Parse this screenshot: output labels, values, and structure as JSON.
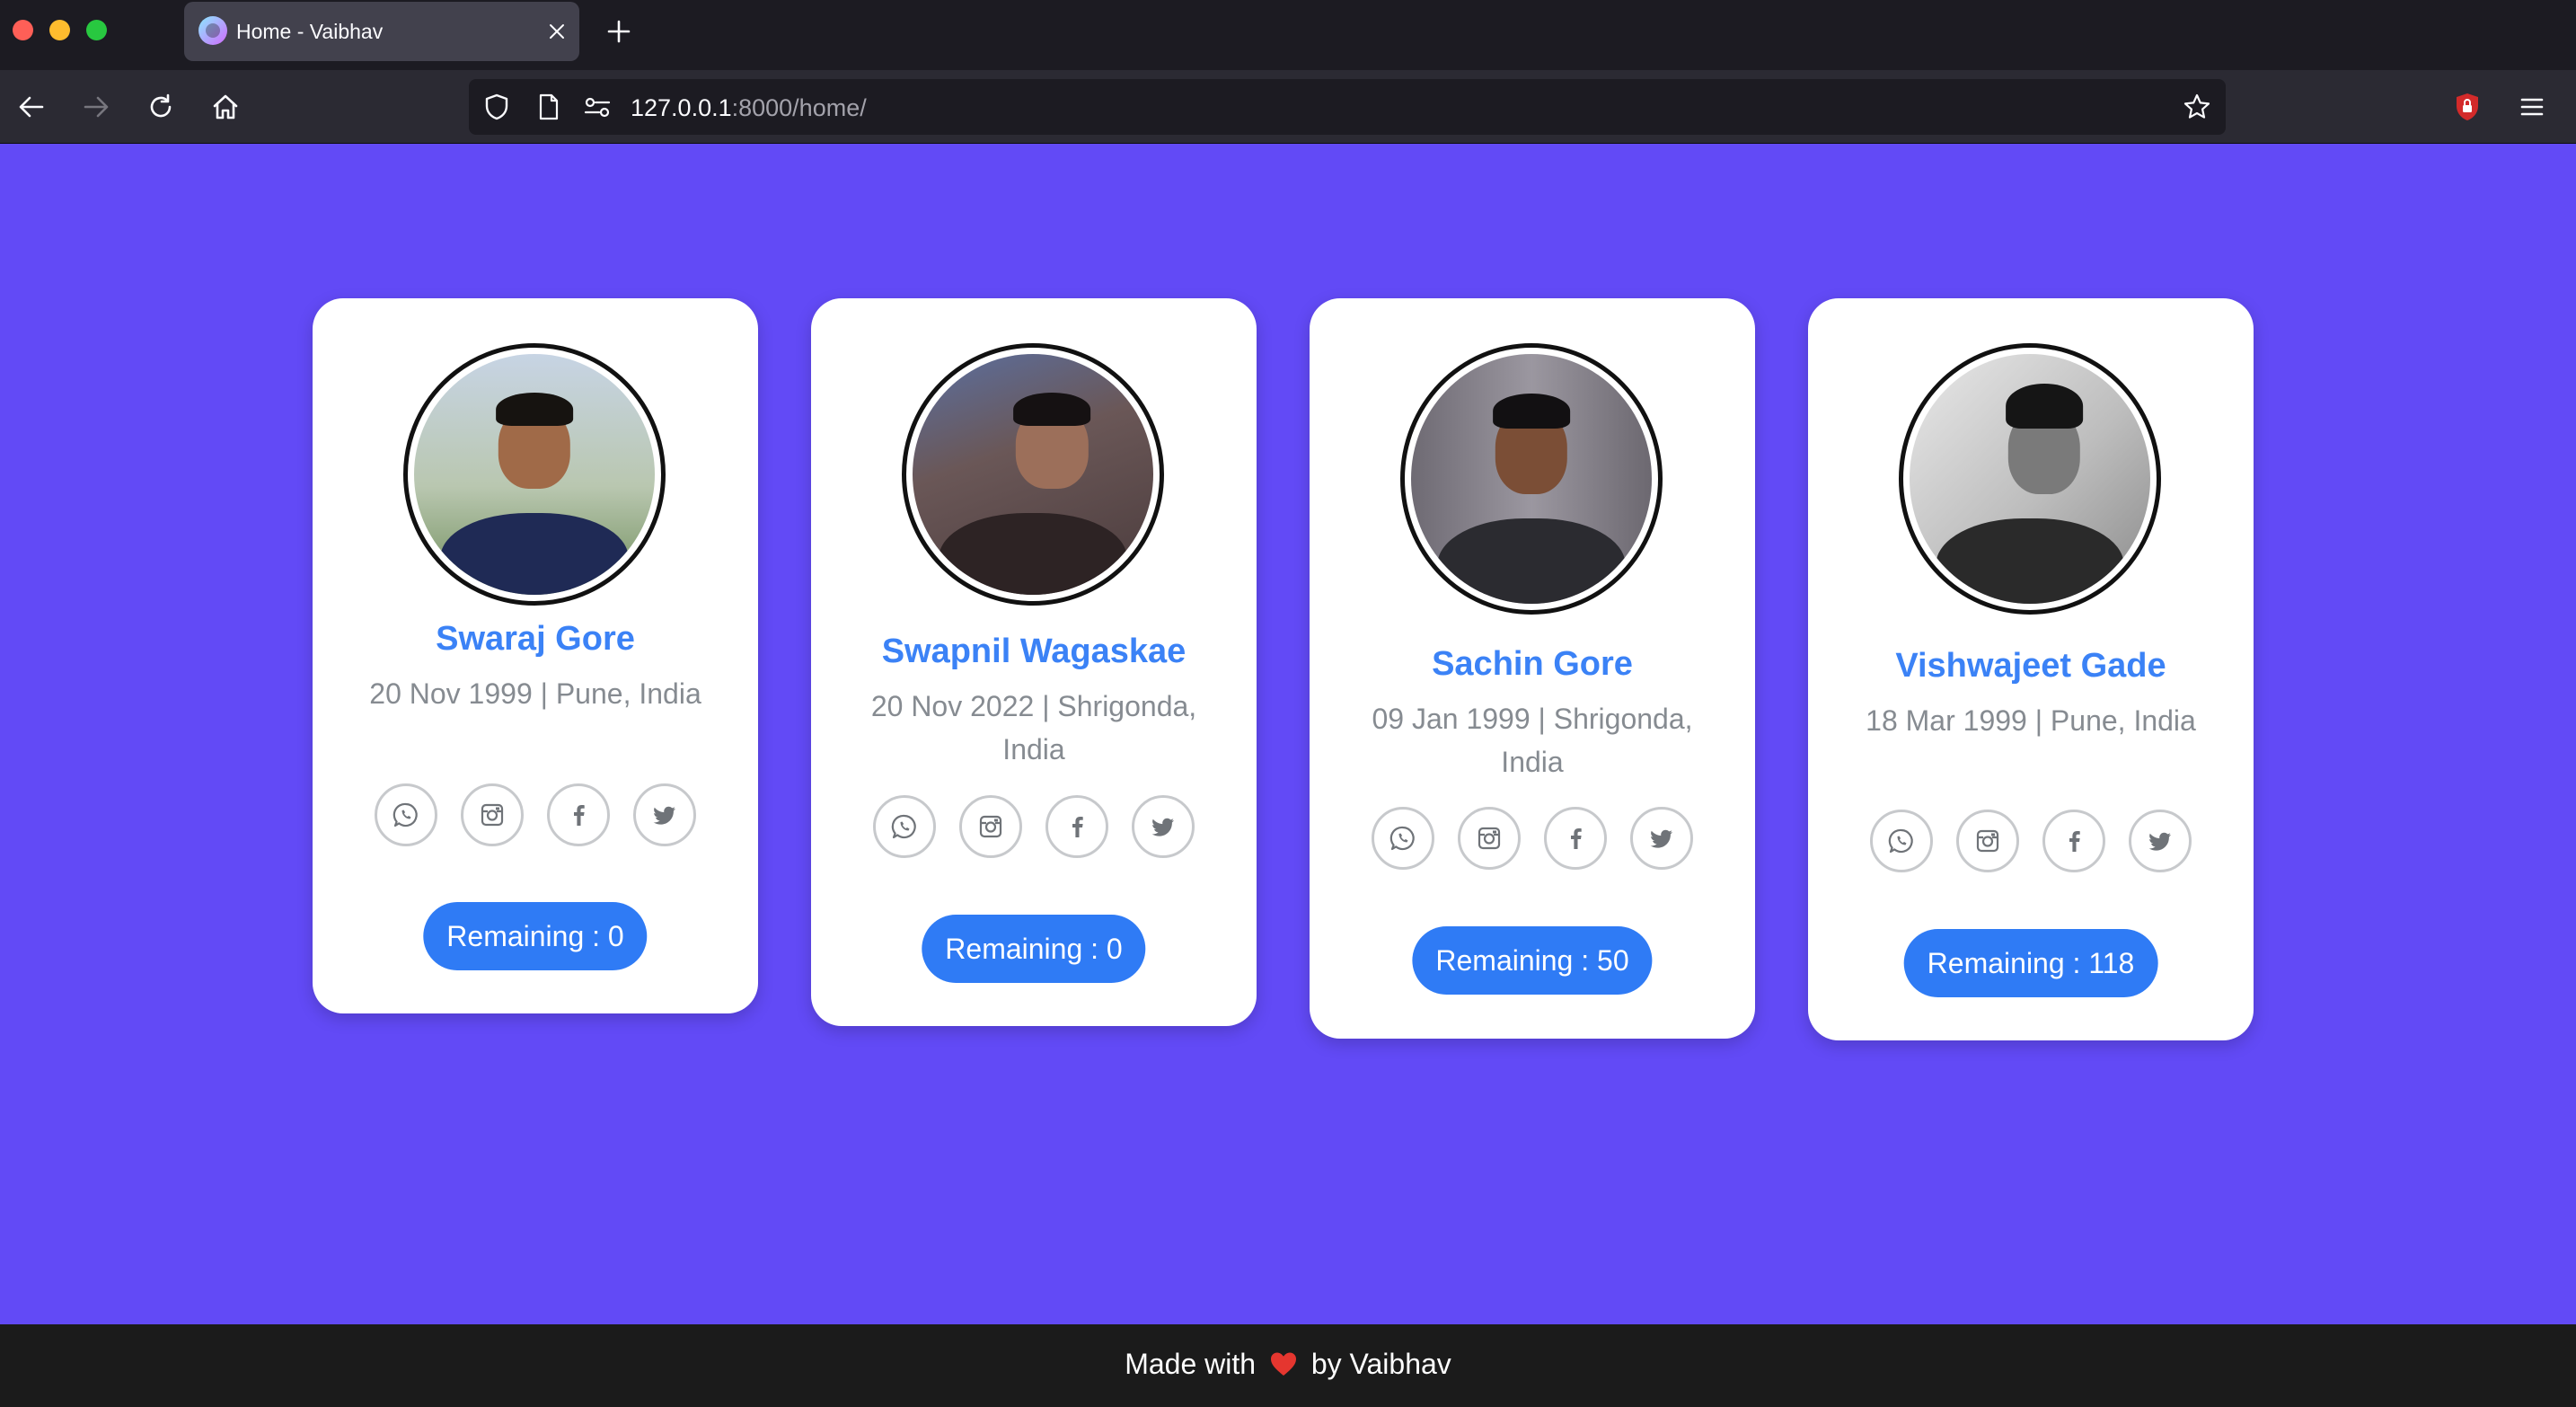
{
  "browser": {
    "tab_title": "Home - Vaibhav",
    "url_host": "127.0.0.1",
    "url_path": ":8000/home/"
  },
  "cards": [
    {
      "name": "Swaraj Gore",
      "info": "20 Nov 1999 | Pune, India",
      "remaining": "Remaining : 0"
    },
    {
      "name": "Swapnil Wagaskae",
      "info": "20 Nov 2022 | Shrigonda, India",
      "remaining": "Remaining : 0"
    },
    {
      "name": "Sachin Gore",
      "info": "09 Jan 1999 | Shrigonda, India",
      "remaining": "Remaining : 50"
    },
    {
      "name": "Vishwajeet Gade",
      "info": "18 Mar 1999 | Pune, India",
      "remaining": "Remaining : 118"
    }
  ],
  "social_icons": [
    "whatsapp-icon",
    "instagram-icon",
    "facebook-icon",
    "twitter-icon"
  ],
  "footer": {
    "made_with": "Made with",
    "by": "by Vaibhav"
  },
  "colors": {
    "page_background": "#624af6",
    "accent_blue": "#3b82f6",
    "pill_blue": "#2f7bf5",
    "footer_background": "#1b1b1b"
  }
}
